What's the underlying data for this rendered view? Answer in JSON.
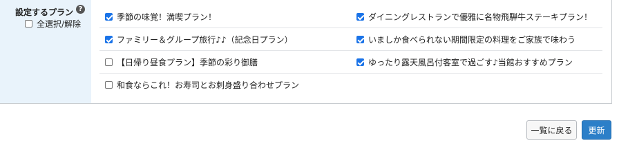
{
  "filter": {
    "label": "設定するプラン",
    "help_icon": "?",
    "select_all_label": "全選択/解除",
    "select_all_checked": false
  },
  "plans": [
    {
      "label": "季節の味覚！満喫プラン！",
      "checked": true
    },
    {
      "label": "ダイニングレストランで優雅に名物飛騨牛ステーキプラン！",
      "checked": true
    },
    {
      "label": "ファミリー＆グループ旅行♪♪（記念日プラン）",
      "checked": true
    },
    {
      "label": "いましか食べられない期間限定の料理をご家族で味わう",
      "checked": true
    },
    {
      "label": "【日帰り昼食プラン】季節の彩り御膳",
      "checked": false
    },
    {
      "label": "ゆったり露天風呂付客室で過ごす♪当館おすすめプラン",
      "checked": true
    },
    {
      "label": "和食ならこれ！お寿司とお刺身盛り合わせプラン",
      "checked": false
    }
  ],
  "actions": {
    "back_label": "一覧に戻る",
    "update_label": "更新"
  },
  "colors": {
    "label_bg": "#e9f3fb",
    "accent": "#2c7fc8",
    "checkbox": "#1a73e8"
  }
}
